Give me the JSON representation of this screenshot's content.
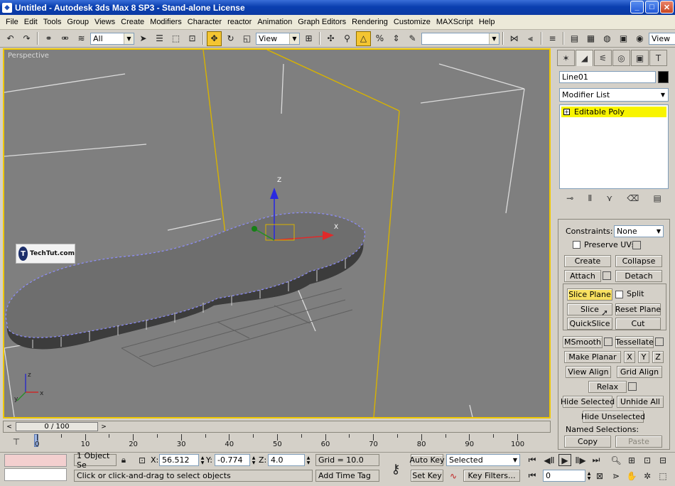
{
  "window": {
    "title": "Untitled - Autodesk 3ds Max 8 SP3 - Stand-alone License",
    "minimize": "_",
    "maximize": "□",
    "close": "✕"
  },
  "menu": [
    "File",
    "Edit",
    "Tools",
    "Group",
    "Views",
    "Create",
    "Modifiers",
    "Character",
    "reactor",
    "Animation",
    "Graph Editors",
    "Rendering",
    "Customize",
    "MAXScript",
    "Help"
  ],
  "toolbar": {
    "selection_filter": "All",
    "coord_system": "View",
    "named_selection": "",
    "render_type": "View",
    "icons": [
      "undo-icon",
      "redo-icon",
      "select-link-icon",
      "unlink-icon",
      "bind-space-warp-icon",
      "select-object-icon",
      "select-by-name-icon",
      "rect-selection-icon",
      "window-crossing-icon",
      "select-move-icon",
      "select-rotate-icon",
      "select-scale-icon",
      "pivot-icon",
      "snap-3d-icon",
      "angle-snap-icon",
      "percent-snap-icon",
      "spinner-snap-icon",
      "edit-named-selection-icon",
      "mirror-icon",
      "align-icon",
      "layer-manager-icon",
      "curve-editor-icon",
      "schematic-icon",
      "material-editor-icon",
      "render-scene-icon",
      "quick-render-icon"
    ]
  },
  "viewport": {
    "label": "Perspective",
    "watermark_text": "TechTut.com",
    "watermark_logo": "T",
    "axis_x": "x",
    "axis_y": "y",
    "axis_z": "z",
    "gizmo_x": "X",
    "gizmo_z": "Z"
  },
  "command_panel": {
    "tabs": [
      "create-tab-icon",
      "modify-tab-icon",
      "hierarchy-tab-icon",
      "motion-tab-icon",
      "display-tab-icon",
      "utilities-tab-icon"
    ],
    "object_name": "Line01",
    "object_color": "#000000",
    "modifier_list": "Modifier List",
    "stack_item": "Editable Poly",
    "stack_item_plus": "+",
    "constraints_label": "Constraints:",
    "constraints_value": "None",
    "preserve_uvs": "Preserve UVs",
    "create": "Create",
    "collapse": "Collapse",
    "attach": "Attach",
    "detach": "Detach",
    "slice_plane": "Slice Plane",
    "split": "Split",
    "slice": "Slice",
    "reset_plane": "Reset Plane",
    "quickslice": "QuickSlice",
    "cut": "Cut",
    "msmooth": "MSmooth",
    "tessellate": "Tessellate",
    "make_planar": "Make Planar",
    "x": "X",
    "y": "Y",
    "z": "Z",
    "view_align": "View Align",
    "grid_align": "Grid Align",
    "relax": "Relax",
    "hide_selected": "Hide Selected",
    "unhide_all": "Unhide All",
    "hide_unselected": "Hide Unselected",
    "named_selections": "Named Selections:",
    "copy": "Copy",
    "paste": "Paste"
  },
  "timeline": {
    "slider_label": "0 / 100",
    "ticks": [
      "0",
      "10",
      "20",
      "30",
      "40",
      "50",
      "60",
      "70",
      "80",
      "90",
      "100"
    ]
  },
  "status": {
    "selection": "1 Object Se",
    "x_label": "X:",
    "x": "56.512",
    "y_label": "Y:",
    "y": "-0.774",
    "z_label": "Z:",
    "z": "4.0",
    "grid": "Grid = 10.0",
    "prompt": "Click or click-and-drag to select objects",
    "add_time_tag": "Add Time Tag",
    "auto_key": "Auto Key",
    "set_key": "Set Key",
    "selected": "Selected",
    "key_filters": "Key Filters...",
    "frame": "0"
  }
}
